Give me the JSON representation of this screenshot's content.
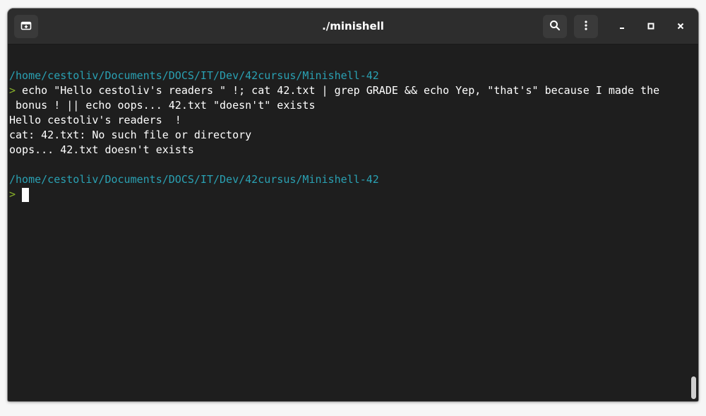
{
  "window": {
    "title": "./minishell"
  },
  "titlebar": {
    "new_tab_icon": "new-tab-icon",
    "search_icon": "search-icon",
    "menu_icon": "kebab-menu-icon",
    "minimize_label": "–",
    "maximize_label": "▫",
    "close_label": "×"
  },
  "colors": {
    "background": "#1e1e1e",
    "titlebar": "#2d2d2d",
    "path": "#2aa1b3",
    "prompt": "#8ab32a",
    "text": "#ffffff"
  },
  "terminal": {
    "lines": [
      {
        "type": "path",
        "text": "/home/cestoliv/Documents/DOCS/IT/Dev/42cursus/Minishell-42"
      },
      {
        "type": "command",
        "prompt": ">",
        "text": " echo \"Hello cestoliv's readers \" !; cat 42.txt | grep GRADE && echo Yep, \"that's\" because I made the"
      },
      {
        "type": "output",
        "text": " bonus ! || echo oops... 42.txt \"doesn't\" exists"
      },
      {
        "type": "output",
        "text": "Hello cestoliv's readers  !"
      },
      {
        "type": "output",
        "text": "cat: 42.txt: No such file or directory"
      },
      {
        "type": "output",
        "text": "oops... 42.txt doesn't exists"
      },
      {
        "type": "path",
        "text": "/home/cestoliv/Documents/DOCS/IT/Dev/42cursus/Minishell-42"
      },
      {
        "type": "prompt",
        "prompt": ">"
      }
    ]
  }
}
